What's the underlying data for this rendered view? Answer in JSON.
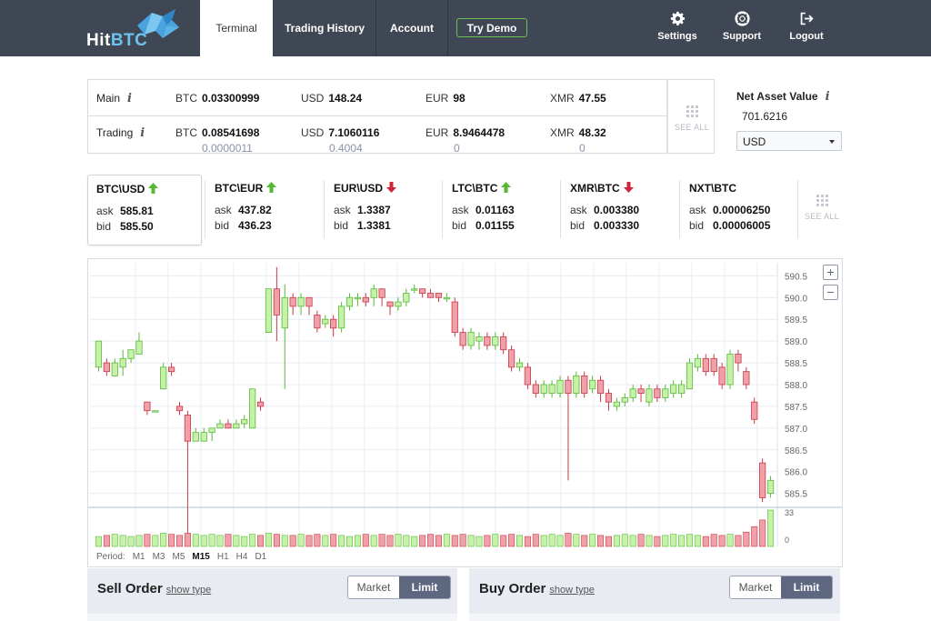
{
  "header": {
    "logo_text_main": "Hit",
    "logo_text_accent": "BTC",
    "tabs": [
      {
        "label": "Terminal",
        "active": true
      },
      {
        "label": "Trading History",
        "active": false
      },
      {
        "label": "Account",
        "active": false
      }
    ],
    "demo_button": "Try Demo",
    "actions": [
      {
        "label": "Settings",
        "icon": "gear-icon"
      },
      {
        "label": "Support",
        "icon": "lifebuoy-icon"
      },
      {
        "label": "Logout",
        "icon": "logout-icon"
      }
    ]
  },
  "balances": {
    "main_label": "Main",
    "trading_label": "Trading",
    "info_glyph": "i",
    "main": [
      {
        "currency": "BTC",
        "amount": "0.03300999"
      },
      {
        "currency": "USD",
        "amount": "148.24"
      },
      {
        "currency": "EUR",
        "amount": "98"
      },
      {
        "currency": "XMR",
        "amount": "47.55"
      }
    ],
    "trading": [
      {
        "currency": "BTC",
        "amount": "0.08541698",
        "sub": "0.0000011"
      },
      {
        "currency": "USD",
        "amount": "7.1060116",
        "sub": "0.4004"
      },
      {
        "currency": "EUR",
        "amount": "8.9464478",
        "sub": "0"
      },
      {
        "currency": "XMR",
        "amount": "48.32",
        "sub": "0"
      }
    ],
    "see_all": "SEE ALL"
  },
  "net_asset": {
    "label": "Net Asset Value",
    "value": "701.6216",
    "currency": "USD"
  },
  "tickers": [
    {
      "pair": "BTC\\USD",
      "dir": "up",
      "ask": "585.81",
      "bid": "585.50",
      "active": true
    },
    {
      "pair": "BTC\\EUR",
      "dir": "up",
      "ask": "437.82",
      "bid": "436.23",
      "active": false
    },
    {
      "pair": "EUR\\USD",
      "dir": "down",
      "ask": "1.3387",
      "bid": "1.3381",
      "active": false
    },
    {
      "pair": "LTC\\BTC",
      "dir": "up",
      "ask": "0.01163",
      "bid": "0.01155",
      "active": false
    },
    {
      "pair": "XMR\\BTC",
      "dir": "down",
      "ask": "0.003380",
      "bid": "0.003330",
      "active": false
    },
    {
      "pair": "NXT\\BTC",
      "dir": "none",
      "ask": "0.00006250",
      "bid": "0.00006005",
      "active": false
    }
  ],
  "ticker_labels": {
    "ask": "ask",
    "bid": "bid",
    "see_all": "SEE ALL"
  },
  "colors": {
    "up": "#55b82f",
    "down": "#d0243a",
    "bull_fill": "#c6f2a8",
    "bull_stroke": "#58b83a",
    "bear_fill": "#f0a1a8",
    "bear_stroke": "#c8384a"
  },
  "chart": {
    "period_label": "Period:",
    "periods": [
      "M1",
      "M3",
      "M5",
      "M15",
      "H1",
      "H4",
      "D1"
    ],
    "selected_period": "M15",
    "zoom_in": "+",
    "zoom_out": "−"
  },
  "chart_data": {
    "type": "candlestick",
    "y_ticks": [
      "590.5",
      "590.0",
      "589.5",
      "589.0",
      "588.5",
      "588.0",
      "587.5",
      "587.0",
      "586.5",
      "586.0",
      "585.5"
    ],
    "ylim": [
      585.2,
      590.8
    ],
    "volume_ticks": [
      "33",
      "0"
    ],
    "volume_max": 33,
    "candles": [
      {
        "o": 588.4,
        "c": 589.0,
        "h": 589.0,
        "l": 588.3,
        "v": 9
      },
      {
        "o": 588.5,
        "c": 588.3,
        "h": 588.6,
        "l": 588.2,
        "v": 10
      },
      {
        "o": 588.2,
        "c": 588.5,
        "h": 588.6,
        "l": 588.2,
        "v": 11
      },
      {
        "o": 588.4,
        "c": 588.6,
        "h": 588.8,
        "l": 588.2,
        "v": 10
      },
      {
        "o": 588.6,
        "c": 588.8,
        "h": 588.8,
        "l": 588.5,
        "v": 9
      },
      {
        "o": 588.7,
        "c": 589.0,
        "h": 589.2,
        "l": 588.7,
        "v": 10
      },
      {
        "o": 587.6,
        "c": 587.4,
        "h": 587.6,
        "l": 587.3,
        "v": 11
      },
      {
        "o": 587.4,
        "c": 587.4,
        "h": 587.4,
        "l": 587.4,
        "v": 10
      },
      {
        "o": 587.9,
        "c": 588.4,
        "h": 588.5,
        "l": 587.9,
        "v": 12
      },
      {
        "o": 588.4,
        "c": 588.3,
        "h": 588.5,
        "l": 588.2,
        "v": 11
      },
      {
        "o": 587.5,
        "c": 587.4,
        "h": 587.6,
        "l": 587.3,
        "v": 10
      },
      {
        "o": 587.3,
        "c": 586.7,
        "h": 587.4,
        "l": 584.3,
        "v": 12
      },
      {
        "o": 586.7,
        "c": 586.9,
        "h": 587.0,
        "l": 586.7,
        "v": 11
      },
      {
        "o": 586.7,
        "c": 586.9,
        "h": 587.0,
        "l": 586.7,
        "v": 10
      },
      {
        "o": 586.9,
        "c": 587.0,
        "h": 587.0,
        "l": 586.7,
        "v": 11
      },
      {
        "o": 587.0,
        "c": 587.1,
        "h": 587.2,
        "l": 587.0,
        "v": 10
      },
      {
        "o": 587.1,
        "c": 587.0,
        "h": 587.2,
        "l": 587.0,
        "v": 11
      },
      {
        "o": 587.0,
        "c": 587.1,
        "h": 587.2,
        "l": 587.0,
        "v": 10
      },
      {
        "o": 587.1,
        "c": 587.2,
        "h": 587.3,
        "l": 587.0,
        "v": 9
      },
      {
        "o": 587.0,
        "c": 587.9,
        "h": 587.9,
        "l": 587.0,
        "v": 11
      },
      {
        "o": 587.6,
        "c": 587.5,
        "h": 587.7,
        "l": 587.4,
        "v": 10
      },
      {
        "o": 589.2,
        "c": 590.2,
        "h": 590.2,
        "l": 589.2,
        "v": 12
      },
      {
        "o": 590.2,
        "c": 589.6,
        "h": 590.7,
        "l": 589.0,
        "v": 11
      },
      {
        "o": 589.3,
        "c": 590.0,
        "h": 590.3,
        "l": 587.9,
        "v": 10
      },
      {
        "o": 590.0,
        "c": 589.8,
        "h": 590.1,
        "l": 589.6,
        "v": 10
      },
      {
        "o": 589.8,
        "c": 590.0,
        "h": 590.1,
        "l": 589.6,
        "v": 11
      },
      {
        "o": 590.0,
        "c": 589.8,
        "h": 590.0,
        "l": 589.6,
        "v": 10
      },
      {
        "o": 589.6,
        "c": 589.3,
        "h": 589.7,
        "l": 589.2,
        "v": 11
      },
      {
        "o": 589.4,
        "c": 589.5,
        "h": 589.6,
        "l": 589.3,
        "v": 10
      },
      {
        "o": 589.5,
        "c": 589.3,
        "h": 589.6,
        "l": 589.1,
        "v": 11
      },
      {
        "o": 589.3,
        "c": 589.8,
        "h": 589.9,
        "l": 589.2,
        "v": 10
      },
      {
        "o": 589.8,
        "c": 590.0,
        "h": 590.1,
        "l": 589.7,
        "v": 9
      },
      {
        "o": 590.0,
        "c": 590.0,
        "h": 590.1,
        "l": 589.8,
        "v": 10
      },
      {
        "o": 590.0,
        "c": 589.9,
        "h": 590.1,
        "l": 589.8,
        "v": 11
      },
      {
        "o": 590.0,
        "c": 590.2,
        "h": 590.3,
        "l": 589.8,
        "v": 10
      },
      {
        "o": 590.2,
        "c": 590.0,
        "h": 590.2,
        "l": 589.8,
        "v": 11
      },
      {
        "o": 589.9,
        "c": 589.8,
        "h": 589.9,
        "l": 589.6,
        "v": 10
      },
      {
        "o": 589.8,
        "c": 589.9,
        "h": 590.0,
        "l": 589.7,
        "v": 11
      },
      {
        "o": 589.9,
        "c": 590.1,
        "h": 590.2,
        "l": 589.8,
        "v": 10
      },
      {
        "o": 590.2,
        "c": 590.2,
        "h": 590.3,
        "l": 590.1,
        "v": 9
      },
      {
        "o": 590.2,
        "c": 590.1,
        "h": 590.2,
        "l": 590.0,
        "v": 10
      },
      {
        "o": 590.1,
        "c": 590.0,
        "h": 590.2,
        "l": 590.0,
        "v": 11
      },
      {
        "o": 590.1,
        "c": 590.0,
        "h": 590.1,
        "l": 589.9,
        "v": 10
      },
      {
        "o": 590.0,
        "c": 590.0,
        "h": 590.1,
        "l": 589.9,
        "v": 11
      },
      {
        "o": 589.9,
        "c": 589.2,
        "h": 590.0,
        "l": 589.1,
        "v": 10
      },
      {
        "o": 589.2,
        "c": 588.9,
        "h": 589.3,
        "l": 588.8,
        "v": 11
      },
      {
        "o": 588.9,
        "c": 589.2,
        "h": 589.3,
        "l": 588.8,
        "v": 10
      },
      {
        "o": 589.0,
        "c": 589.1,
        "h": 589.2,
        "l": 588.8,
        "v": 9
      },
      {
        "o": 589.1,
        "c": 588.9,
        "h": 589.2,
        "l": 588.8,
        "v": 10
      },
      {
        "o": 588.9,
        "c": 589.1,
        "h": 589.2,
        "l": 588.8,
        "v": 11
      },
      {
        "o": 589.1,
        "c": 588.8,
        "h": 589.2,
        "l": 588.7,
        "v": 10
      },
      {
        "o": 588.8,
        "c": 588.4,
        "h": 588.9,
        "l": 588.3,
        "v": 11
      },
      {
        "o": 588.4,
        "c": 588.5,
        "h": 588.6,
        "l": 588.3,
        "v": 10
      },
      {
        "o": 588.4,
        "c": 588.0,
        "h": 588.5,
        "l": 587.9,
        "v": 9
      },
      {
        "o": 588.0,
        "c": 587.8,
        "h": 588.1,
        "l": 587.7,
        "v": 11
      },
      {
        "o": 587.8,
        "c": 588.0,
        "h": 588.1,
        "l": 587.7,
        "v": 10
      },
      {
        "o": 587.8,
        "c": 588.0,
        "h": 588.1,
        "l": 587.7,
        "v": 11
      },
      {
        "o": 587.8,
        "c": 588.1,
        "h": 588.2,
        "l": 587.7,
        "v": 10
      },
      {
        "o": 588.1,
        "c": 587.8,
        "h": 588.2,
        "l": 585.8,
        "v": 12
      },
      {
        "o": 587.8,
        "c": 588.2,
        "h": 588.3,
        "l": 587.7,
        "v": 11
      },
      {
        "o": 588.2,
        "c": 587.8,
        "h": 588.3,
        "l": 587.7,
        "v": 10
      },
      {
        "o": 587.9,
        "c": 588.1,
        "h": 588.2,
        "l": 587.8,
        "v": 11
      },
      {
        "o": 588.1,
        "c": 587.8,
        "h": 588.2,
        "l": 587.6,
        "v": 10
      },
      {
        "o": 587.8,
        "c": 587.6,
        "h": 587.9,
        "l": 587.4,
        "v": 9
      },
      {
        "o": 587.5,
        "c": 587.6,
        "h": 587.7,
        "l": 587.4,
        "v": 10
      },
      {
        "o": 587.6,
        "c": 587.7,
        "h": 587.8,
        "l": 587.5,
        "v": 11
      },
      {
        "o": 587.7,
        "c": 587.9,
        "h": 588.0,
        "l": 587.6,
        "v": 10
      },
      {
        "o": 587.9,
        "c": 587.8,
        "h": 588.0,
        "l": 587.6,
        "v": 11
      },
      {
        "o": 587.6,
        "c": 587.9,
        "h": 588.0,
        "l": 587.5,
        "v": 10
      },
      {
        "o": 587.9,
        "c": 587.7,
        "h": 588.0,
        "l": 587.6,
        "v": 9
      },
      {
        "o": 587.7,
        "c": 587.9,
        "h": 588.0,
        "l": 587.6,
        "v": 10
      },
      {
        "o": 587.8,
        "c": 588.0,
        "h": 588.1,
        "l": 587.7,
        "v": 11
      },
      {
        "o": 587.8,
        "c": 588.0,
        "h": 588.1,
        "l": 587.7,
        "v": 10
      },
      {
        "o": 587.9,
        "c": 588.5,
        "h": 588.6,
        "l": 587.9,
        "v": 11
      },
      {
        "o": 588.4,
        "c": 588.6,
        "h": 588.7,
        "l": 588.3,
        "v": 10
      },
      {
        "o": 588.6,
        "c": 588.3,
        "h": 588.7,
        "l": 588.2,
        "v": 9
      },
      {
        "o": 588.6,
        "c": 588.3,
        "h": 588.7,
        "l": 588.2,
        "v": 11
      },
      {
        "o": 588.4,
        "c": 588.0,
        "h": 588.5,
        "l": 587.9,
        "v": 10
      },
      {
        "o": 588.0,
        "c": 588.7,
        "h": 588.8,
        "l": 587.9,
        "v": 11
      },
      {
        "o": 588.7,
        "c": 588.5,
        "h": 588.8,
        "l": 588.3,
        "v": 10
      },
      {
        "o": 588.3,
        "c": 588.0,
        "h": 588.4,
        "l": 587.9,
        "v": 13
      },
      {
        "o": 587.6,
        "c": 587.2,
        "h": 587.7,
        "l": 587.1,
        "v": 18
      },
      {
        "o": 586.2,
        "c": 585.4,
        "h": 586.3,
        "l": 585.3,
        "v": 24
      },
      {
        "o": 585.5,
        "c": 585.8,
        "h": 585.9,
        "l": 585.4,
        "v": 33
      }
    ]
  },
  "orders": {
    "sell_title": "Sell Order",
    "buy_title": "Buy Order",
    "show_type": "show type",
    "market": "Market",
    "limit": "Limit"
  }
}
